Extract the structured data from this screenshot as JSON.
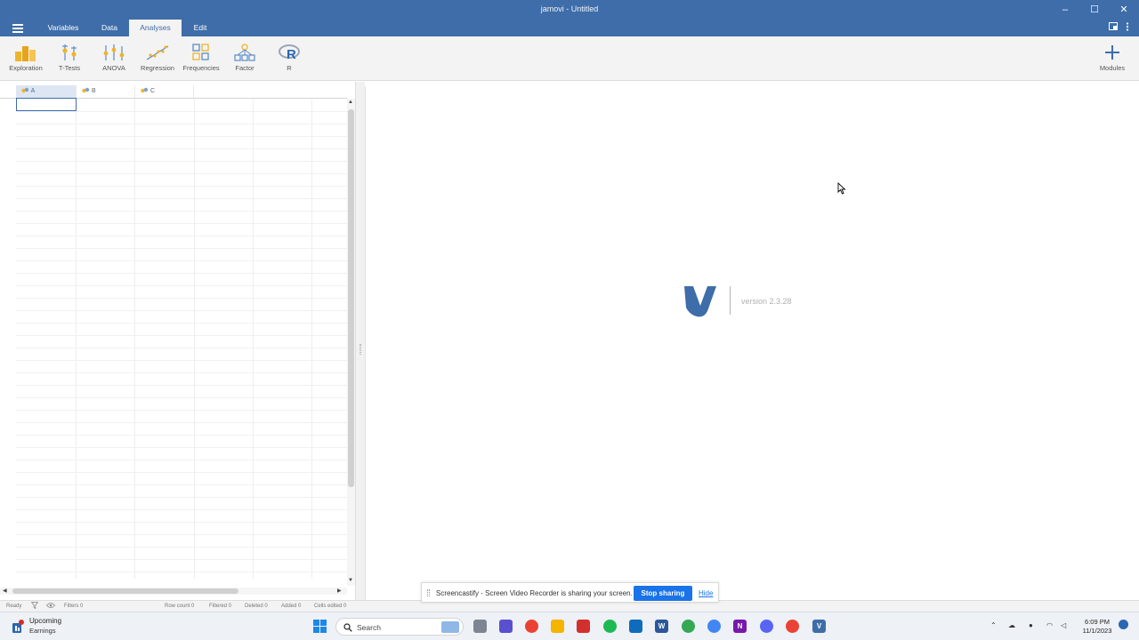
{
  "window": {
    "title": "jamovi - Untitled",
    "controls": {
      "minimize": "–",
      "maximize": "☐",
      "close": "✕"
    }
  },
  "menu": {
    "tabs": [
      {
        "label": "Variables"
      },
      {
        "label": "Data"
      },
      {
        "label": "Analyses",
        "active": true
      },
      {
        "label": "Edit"
      }
    ]
  },
  "ribbon": {
    "buttons": [
      {
        "label": "Exploration",
        "icon": "exploration-icon"
      },
      {
        "label": "T-Tests",
        "icon": "ttests-icon"
      },
      {
        "label": "ANOVA",
        "icon": "anova-icon"
      },
      {
        "label": "Regression",
        "icon": "regression-icon"
      },
      {
        "label": "Frequencies",
        "icon": "frequencies-icon"
      },
      {
        "label": "Factor",
        "icon": "factor-icon"
      },
      {
        "label": "R",
        "icon": "r-icon"
      }
    ],
    "modules_label": "Modules"
  },
  "spreadsheet": {
    "columns": [
      {
        "name": "A",
        "selected": true
      },
      {
        "name": "B"
      },
      {
        "name": "C"
      }
    ]
  },
  "results": {
    "version_text": "version 2.3.28"
  },
  "status": {
    "ready": "Ready",
    "filters": "Filters 0",
    "row_count": "Row count 0",
    "filtered": "Filtered 0",
    "deleted": "Deleted 0",
    "added": "Added 0",
    "cells_edited": "Cells edited 0"
  },
  "screencastify": {
    "message": "Screencastify - Screen Video Recorder is sharing your screen.",
    "stop_label": "Stop sharing",
    "hide_label": "Hide"
  },
  "taskbar": {
    "weather_title": "Upcoming",
    "weather_sub": "Earnings",
    "weather_badge": "1",
    "search_placeholder": "Search",
    "time": "6:09 PM",
    "date": "11/1/2023"
  },
  "colors": {
    "accent": "#3e6da9",
    "ribbon_bg": "#f3f3f3",
    "button_blue": "#1a73e8"
  }
}
